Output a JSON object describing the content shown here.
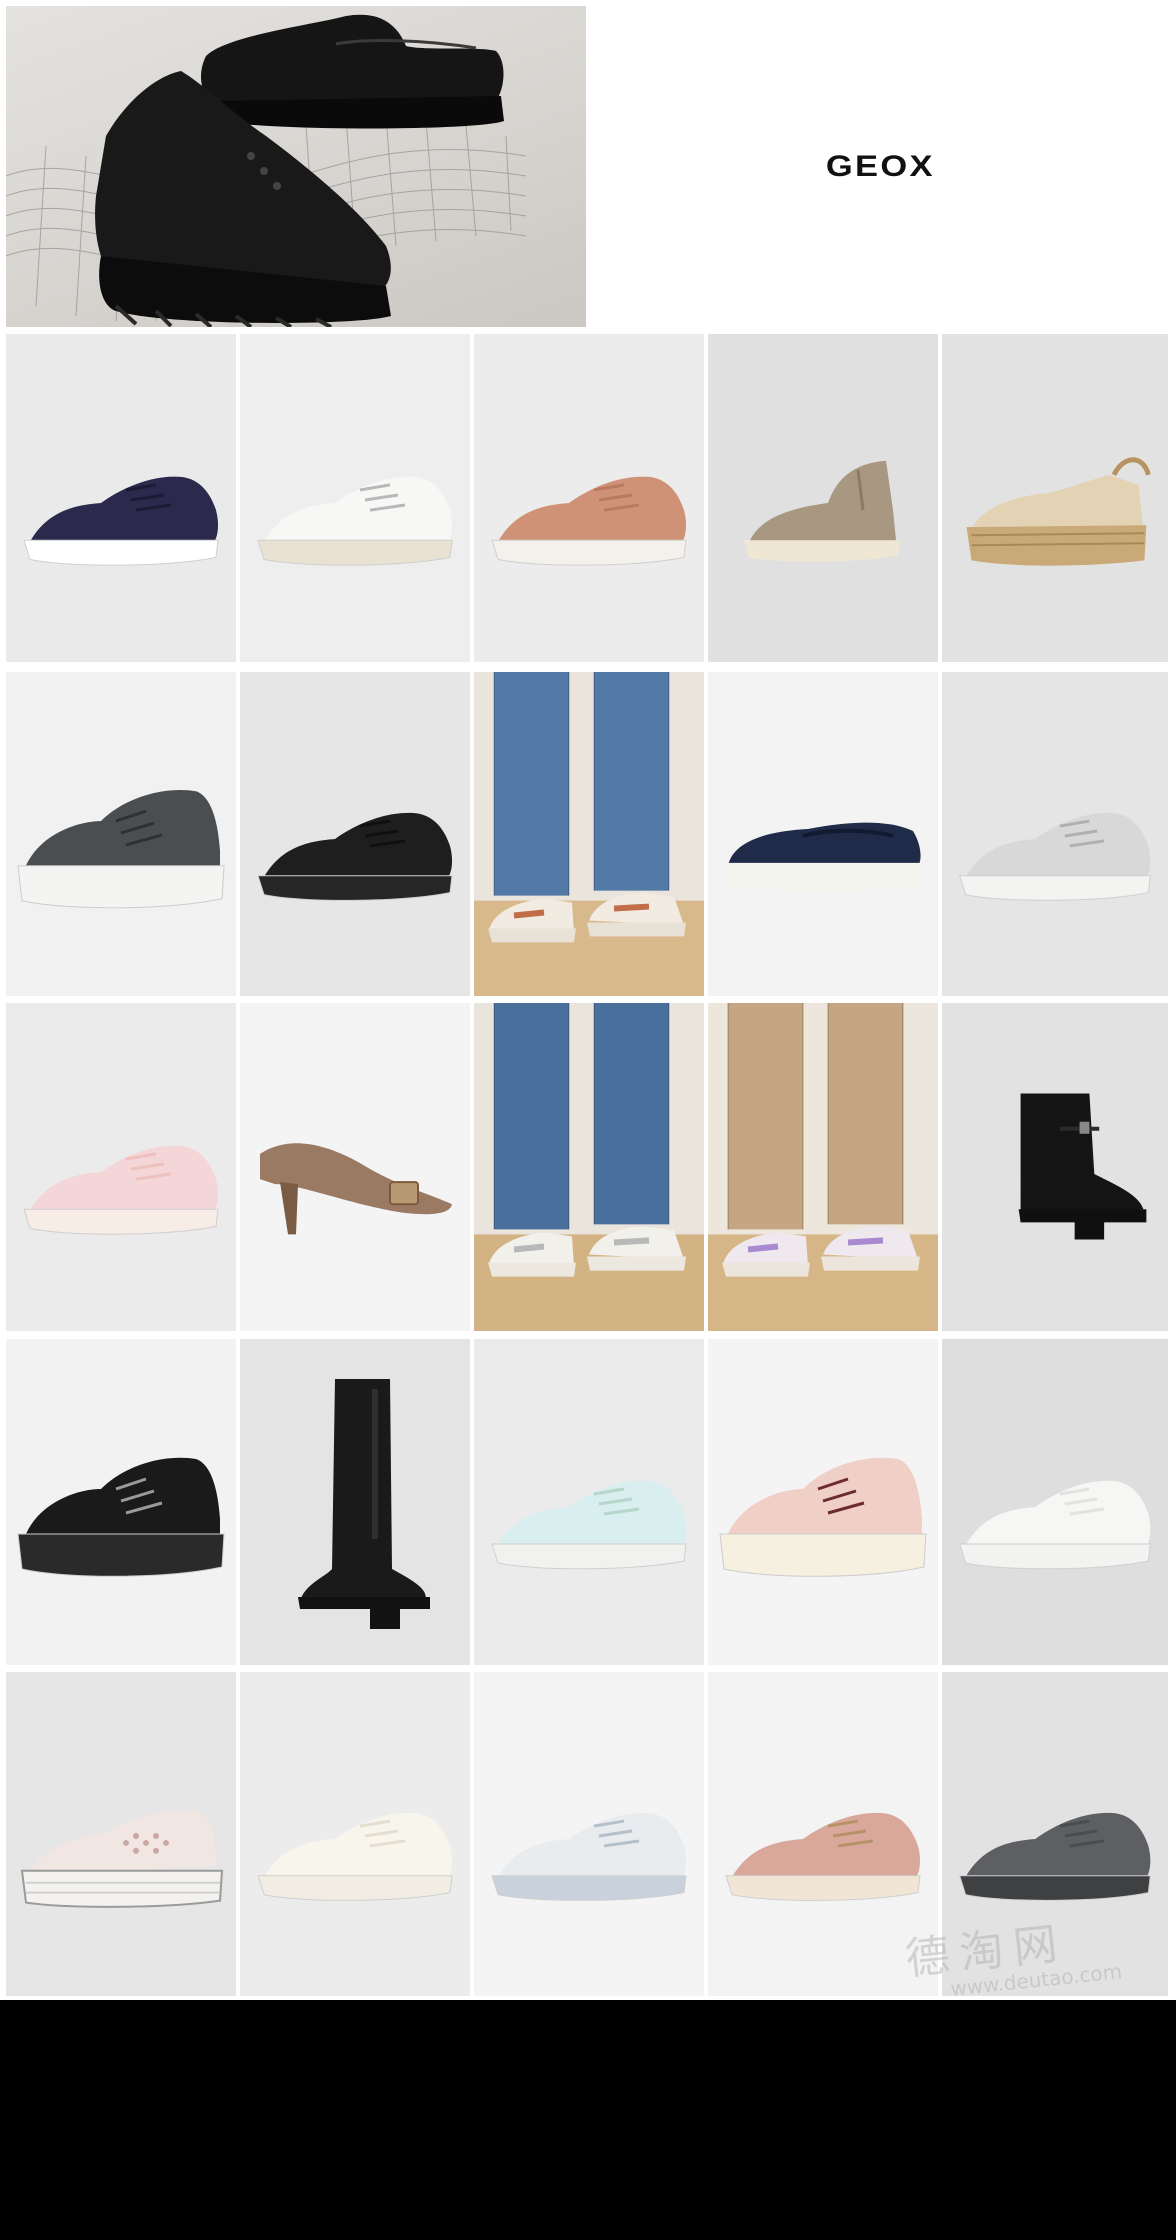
{
  "brand": {
    "logo_text": "GEOX"
  },
  "watermark": {
    "text": "德淘网",
    "url": "www.deutao.com"
  },
  "products": [
    {
      "kind": "sneaker",
      "bg": "#eaeaea",
      "upper": "#2b2a4c",
      "sole": "#ffffff",
      "accent": "#1c1b36"
    },
    {
      "kind": "sneaker",
      "bg": "#eeeeee",
      "upper": "#f7f7f5",
      "sole": "#e9e2d3",
      "accent": "#b8b8b8"
    },
    {
      "kind": "sneaker",
      "bg": "#ececec",
      "upper": "#cf9276",
      "sole": "#f4f1ec",
      "accent": "#b87a60"
    },
    {
      "kind": "hightop",
      "bg": "#e0e0e0",
      "upper": "#a89882",
      "sole": "#efe7d4",
      "accent": "#8a7a66"
    },
    {
      "kind": "espadrille",
      "bg": "#e2e2e2",
      "upper": "#e3d2b4",
      "sole": "#c9a977",
      "accent": "#b89361"
    },
    {
      "kind": "chunky",
      "bg": "#f1f1f1",
      "upper": "#4a4e50",
      "sole": "#f4f4f2",
      "accent": "#2e3133"
    },
    {
      "kind": "sneaker",
      "bg": "#e6e6e6",
      "upper": "#1e1e1e",
      "sole": "#262626",
      "accent": "#101010"
    },
    {
      "kind": "lifestyle",
      "bg": "#e9e4dc",
      "upper": "#f1ebe2",
      "sole": "#e8e1d6",
      "accent": "#c06d48",
      "pants": "#5379a6",
      "floor": "#d8b98c"
    },
    {
      "kind": "loafer",
      "bg": "#f3f3f3",
      "upper": "#1f2b48",
      "sole": "#f4f4ee",
      "accent": "#111a30"
    },
    {
      "kind": "sneaker",
      "bg": "#e5e5e5",
      "upper": "#d8d8d8",
      "sole": "#f3f3f1",
      "accent": "#b0b0b0"
    },
    {
      "kind": "sneaker",
      "bg": "#ebebeb",
      "upper": "#f5d6d8",
      "sole": "#f7ece6",
      "accent": "#eec1bd"
    },
    {
      "kind": "pump",
      "bg": "#f4f4f4",
      "upper": "#9a7a62",
      "sole": "#7a5c45",
      "accent": "#b89a72"
    },
    {
      "kind": "lifestyle",
      "bg": "#e9e4dc",
      "upper": "#f2f0ea",
      "sole": "#ece8df",
      "accent": "#b8b8b8",
      "pants": "#4b6f9c",
      "floor": "#d3b384"
    },
    {
      "kind": "lifestyle",
      "bg": "#ece6dc",
      "upper": "#efe9ef",
      "sole": "#ebe5dc",
      "accent": "#a98ad0",
      "pants": "#c5a584",
      "floor": "#d6b687"
    },
    {
      "kind": "boot",
      "bg": "#e2e2e2",
      "upper": "#141414",
      "sole": "#101010",
      "accent": "#2a2a2a"
    },
    {
      "kind": "chunky",
      "bg": "#f2f2f2",
      "upper": "#1a1a1a",
      "sole": "#2a2a2a",
      "accent": "#9a9a9a"
    },
    {
      "kind": "tallboot",
      "bg": "#e4e4e4",
      "upper": "#1a1a1a",
      "sole": "#121212",
      "accent": "#2f2f2f"
    },
    {
      "kind": "sneaker",
      "bg": "#ebebeb",
      "upper": "#d9eeee",
      "sole": "#f1f1ef",
      "accent": "#b6d6cc"
    },
    {
      "kind": "chunky",
      "bg": "#f4f4f4",
      "upper": "#efcfc6",
      "sole": "#f6f0e1",
      "accent": "#6e2a33"
    },
    {
      "kind": "sneaker",
      "bg": "#dedede",
      "upper": "#f6f6f4",
      "sole": "#f2f2f0",
      "accent": "#e2e2e0"
    },
    {
      "kind": "platform",
      "bg": "#e6e6e6",
      "upper": "#f1e6e2",
      "sole": "#f4f2ee",
      "accent": "#9a9a9a"
    },
    {
      "kind": "sneaker",
      "bg": "#ececec",
      "upper": "#f7f5ec",
      "sole": "#f1ede2",
      "accent": "#e4ded0"
    },
    {
      "kind": "sneaker",
      "bg": "#f4f4f4",
      "upper": "#e9ecef",
      "sole": "#c9d2dc",
      "accent": "#b4bfcb"
    },
    {
      "kind": "sneaker",
      "bg": "#f3f3f3",
      "upper": "#d9a89a",
      "sole": "#f1e6d6",
      "accent": "#b79268"
    },
    {
      "kind": "sneaker",
      "bg": "#e2e2e2",
      "upper": "#5d5f63",
      "sole": "#3e4042",
      "accent": "#4a4c50"
    }
  ]
}
